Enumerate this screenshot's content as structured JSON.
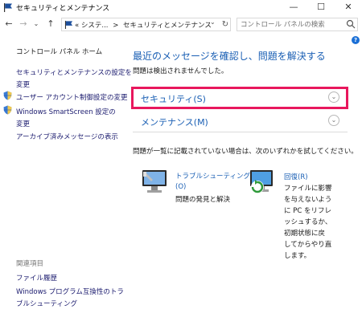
{
  "window": {
    "title": "セキュリティとメンテナンス",
    "minimize": "—",
    "maximize": "☐",
    "close": "✕"
  },
  "nav": {
    "back": "←",
    "forward": "→",
    "history": "⌄",
    "up": "↑"
  },
  "address": {
    "chevrons": "«",
    "crumb1": "システ...",
    "sep": ">",
    "crumb2": "セキュリティとメンテナンス",
    "dropdown": "⌄",
    "refresh": "↻"
  },
  "search": {
    "placeholder": "コントロール パネルの検索"
  },
  "help": "?",
  "left": {
    "home": "コントロール パネル ホーム",
    "settings_line1": "セキュリティとメンテナンスの設定を",
    "settings_line2": "変更",
    "uac": "ユーザー アカウント制御設定の変更",
    "smartscreen_line1": "Windows SmartScreen 設定の",
    "smartscreen_line2": "変更",
    "archived": "アーカイブ済みメッセージの表示",
    "related_title": "関連項目",
    "file_history": "ファイル履歴",
    "compat_line1": "Windows プログラム互換性のトラ",
    "compat_line2": "ブルシューティング"
  },
  "main": {
    "heading": "最近のメッセージを確認し、問題を解決する",
    "no_issues": "問題は検出されませんでした。",
    "security": "セキュリティ(S)",
    "maintenance": "メンテナンス(M)",
    "hint": "問題が一覧に記載されていない場合は、次のいずれかを試してください。",
    "troubleshoot_title_line1": "トラブルシューティング",
    "troubleshoot_title_line2": "(O)",
    "troubleshoot_desc": "問題の発見と解決",
    "recovery_title": "回復(R)",
    "recovery_desc": [
      "ファイルに影響",
      "を与えないよう",
      "に PC をリフレ",
      "ッシュするか、",
      "初期状態に戻",
      "してからやり直",
      "します。"
    ]
  },
  "colors": {
    "link": "#1a5fb4",
    "highlight": "#e8175d"
  }
}
